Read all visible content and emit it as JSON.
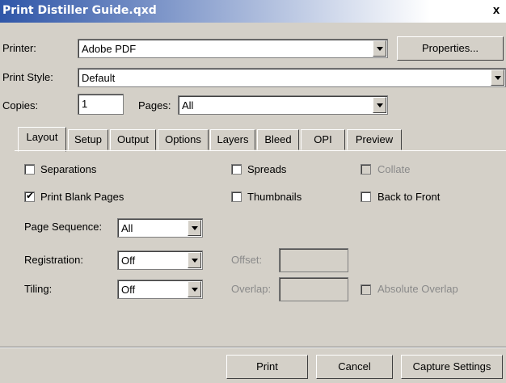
{
  "window": {
    "title": "Print Distiller Guide.qxd",
    "close_label": "x"
  },
  "printer": {
    "label": "Printer:",
    "value": "Adobe PDF",
    "properties_button": "Properties..."
  },
  "print_style": {
    "label": "Print Style:",
    "value": "Default"
  },
  "copies": {
    "label": "Copies:",
    "value": "1"
  },
  "pages": {
    "label": "Pages:",
    "value": "All"
  },
  "tabs": [
    "Layout",
    "Setup",
    "Output",
    "Options",
    "Layers",
    "Bleed",
    "OPI",
    "Preview"
  ],
  "active_tab": "Layout",
  "checkboxes": {
    "separations": {
      "label": "Separations",
      "checked": false
    },
    "spreads": {
      "label": "Spreads",
      "checked": false
    },
    "collate": {
      "label": "Collate",
      "checked": false,
      "disabled": true
    },
    "print_blank_pages": {
      "label": "Print Blank Pages",
      "checked": true
    },
    "thumbnails": {
      "label": "Thumbnails",
      "checked": false
    },
    "back_to_front": {
      "label": "Back to Front",
      "checked": false
    },
    "absolute_overlap": {
      "label": "Absolute Overlap",
      "checked": false,
      "disabled": true
    }
  },
  "page_sequence": {
    "label": "Page Sequence:",
    "value": "All"
  },
  "registration": {
    "label": "Registration:",
    "value": "Off"
  },
  "offset": {
    "label": "Offset:",
    "value": ""
  },
  "tiling": {
    "label": "Tiling:",
    "value": "Off"
  },
  "overlap": {
    "label": "Overlap:",
    "value": ""
  },
  "buttons": {
    "print": "Print",
    "cancel": "Cancel",
    "capture": "Capture Settings"
  }
}
